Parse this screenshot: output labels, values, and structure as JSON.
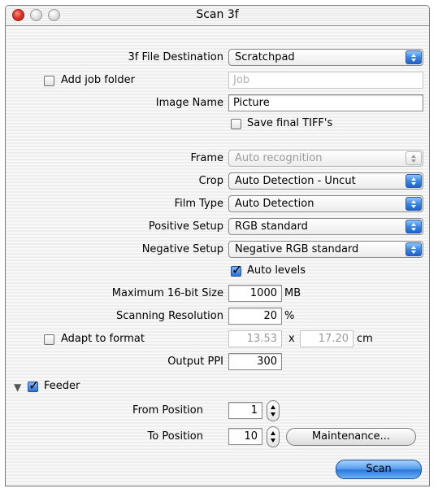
{
  "window": {
    "title": "Scan 3f"
  },
  "form": {
    "destination": {
      "label": "3f File Destination",
      "value": "Scratchpad"
    },
    "add_job_folder": {
      "label": "Add job folder",
      "checked": false,
      "placeholder": "Job"
    },
    "image_name": {
      "label": "Image Name",
      "value": "Picture"
    },
    "save_final_tiffs": {
      "label": "Save final TIFF's",
      "checked": false
    },
    "frame": {
      "label": "Frame",
      "value": "Auto recognition",
      "enabled": false
    },
    "crop": {
      "label": "Crop",
      "value": "Auto Detection - Uncut"
    },
    "film_type": {
      "label": "Film Type",
      "value": "Auto Detection"
    },
    "positive_setup": {
      "label": "Positive Setup",
      "value": "RGB standard"
    },
    "negative_setup": {
      "label": "Negative Setup",
      "value": "Negative RGB standard"
    },
    "auto_levels": {
      "label": "Auto levels",
      "checked": true
    },
    "max_size": {
      "label": "Maximum 16-bit Size",
      "value": "1000",
      "unit": "MB"
    },
    "scan_resolution": {
      "label": "Scanning Resolution",
      "value": "20",
      "unit": "%"
    },
    "adapt_format": {
      "label": "Adapt to format",
      "checked": false,
      "width": "13.53",
      "separator": "x",
      "height": "17.20",
      "unit": "cm"
    },
    "output_ppi": {
      "label": "Output PPI",
      "value": "300"
    }
  },
  "feeder": {
    "label": "Feeder",
    "checked": true,
    "expanded": true,
    "from_position": {
      "label": "From Position",
      "value": "1"
    },
    "to_position": {
      "label": "To Position",
      "value": "10"
    },
    "maintenance_label": "Maintenance..."
  },
  "actions": {
    "scan_label": "Scan"
  },
  "icons": {
    "close": "close-icon",
    "minimize": "minimize-icon",
    "zoom": "zoom-icon",
    "disclosure": "disclosure-triangle-icon",
    "checkmark": "checkmark-icon",
    "popup_arrows": "popup-arrows-icon",
    "stepper": "stepper-icon"
  },
  "colors": {
    "accent": "#3a86e6",
    "close_button": "#e3372a"
  }
}
